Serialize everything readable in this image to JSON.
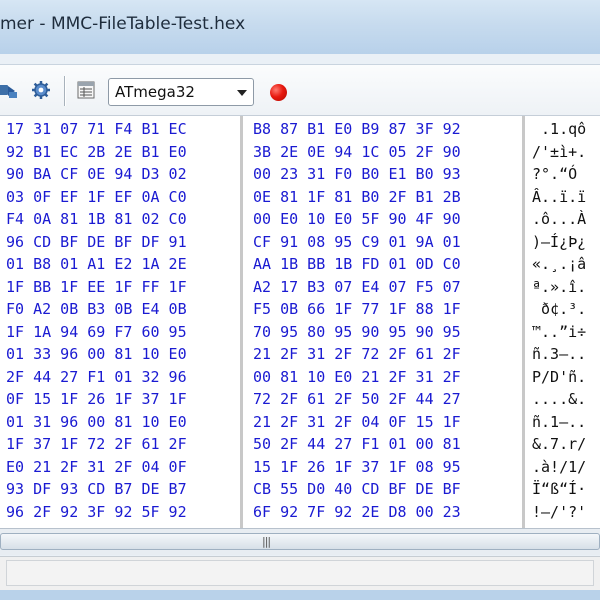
{
  "window": {
    "title": "mer - MMC-FileTable-Test.hex"
  },
  "toolbar": {
    "icons": [
      "upload-chip-icon",
      "gear-icon",
      "memory-view-icon",
      "record-icon"
    ],
    "device_select": {
      "value": "ATmega32"
    },
    "record_color": "#e81a10"
  },
  "hex": {
    "rows": [
      {
        "a": "17 31 07 71 F4 B1 EC",
        "b": "B8 87 B1 E0 B9 87 3F 92",
        "c": " .1.qô"
      },
      {
        "a": "92 B1 EC 2B 2E B1 E0",
        "b": "3B 2E 0E 94 1C 05 2F 90",
        "c": "/'±ì+."
      },
      {
        "a": "90 BA CF 0E 94 D3 02",
        "b": "00 23 31 F0 B0 E1 B0 93",
        "c": "?°.“Ó"
      },
      {
        "a": "03 0F EF 1F EF 0A C0",
        "b": "0E 81 1F 81 B0 2F B1 2B",
        "c": "Â..ï.ï"
      },
      {
        "a": "F4 0A 81 1B 81 02 C0",
        "b": "00 E0 10 E0 5F 90 4F 90",
        "c": ".ô...À"
      },
      {
        "a": "96 CD BF DE BF DF 91",
        "b": "CF 91 08 95 C9 01 9A 01",
        "c": ")–Í¿Þ¿"
      },
      {
        "a": "01 B8 01 A1 E2 1A 2E",
        "b": "AA 1B BB 1B FD 01 0D C0",
        "c": "«.¸.¡â"
      },
      {
        "a": "1F BB 1F EE 1F FF 1F",
        "b": "A2 17 B3 07 E4 07 F5 07",
        "c": "ª.».î."
      },
      {
        "a": "F0 A2 0B B3 0B E4 0B",
        "b": "F5 0B 66 1F 77 1F 88 1F",
        "c": " ð¢.³."
      },
      {
        "a": "1F 1A 94 69 F7 60 95",
        "b": "70 95 80 95 90 95 90 95",
        "c": "™..”i÷"
      },
      {
        "a": "01 33 96 00 81 10 E0",
        "b": "21 2F 31 2F 72 2F 61 2F",
        "c": "ñ.3–.."
      },
      {
        "a": "2F 44 27 F1 01 32 96",
        "b": "00 81 10 E0 21 2F 31 2F",
        "c": "P/D'ñ."
      },
      {
        "a": "0F 15 1F 26 1F 37 1F",
        "b": "72 2F 61 2F 50 2F 44 27",
        "c": "....&."
      },
      {
        "a": "01 31 96 00 81 10 E0",
        "b": "21 2F 31 2F 04 0F 15 1F",
        "c": "ñ.1–.."
      },
      {
        "a": "1F 37 1F 72 2F 61 2F",
        "b": "50 2F 44 27 F1 01 00 81",
        "c": "&.7.r/"
      },
      {
        "a": "E0 21 2F 31 2F 04 0F",
        "b": "15 1F 26 1F 37 1F 08 95",
        "c": ".à!/1/"
      },
      {
        "a": "93 DF 93 CD B7 DE B7",
        "b": "CB 55 D0 40 CD BF DE BF",
        "c": "Ï“ß“Í·"
      },
      {
        "a": "96 2F 92 3F 92 5F 92",
        "b": "6F 92 7F 92 2E D8 00 23",
        "c": "!–/'?'"
      }
    ]
  }
}
